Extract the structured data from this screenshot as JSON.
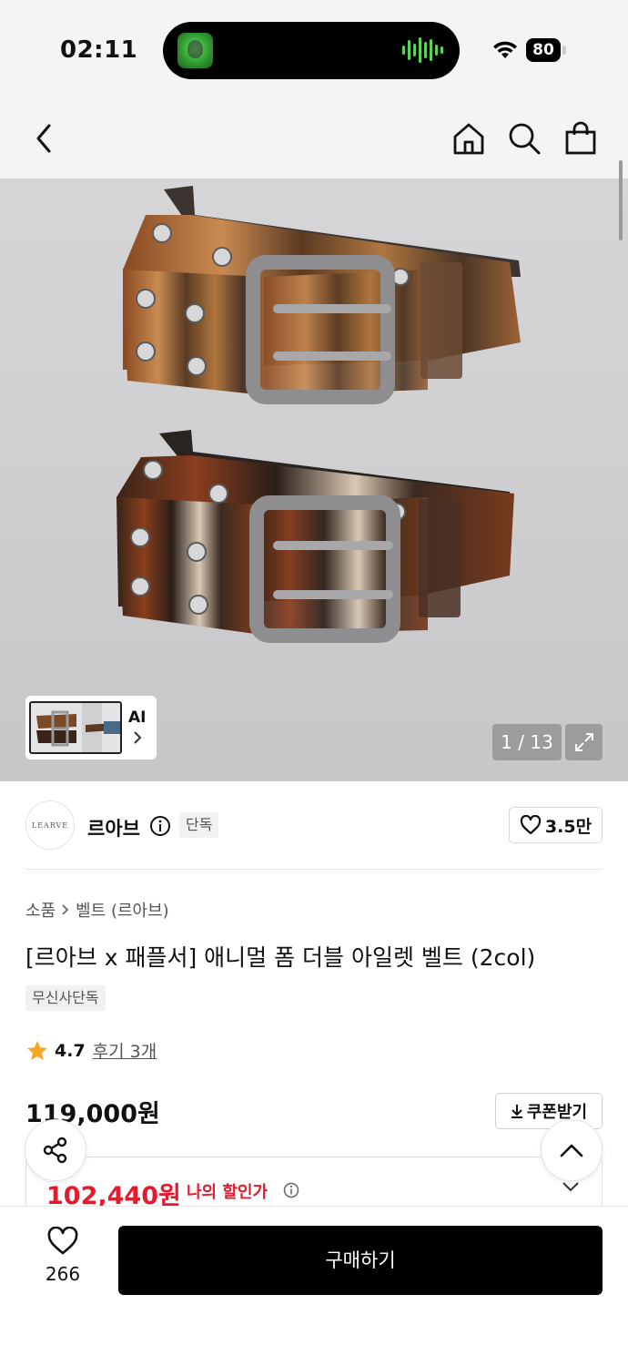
{
  "status_bar": {
    "time": "02:11",
    "battery": "80"
  },
  "top_nav": {
    "icons": [
      "back-icon",
      "home-icon",
      "search-icon",
      "bag-icon"
    ]
  },
  "gallery": {
    "thumbnail_label": "AI",
    "page_counter": "1 / 13",
    "current_index": 1,
    "total_images": 13
  },
  "brand": {
    "logo_text": "LEARVE",
    "name": "르아브",
    "exclusive_tag": "단독",
    "like_count": "3.5만"
  },
  "product": {
    "breadcrumb": [
      "소품",
      "벨트 (르아브)"
    ],
    "title": "[르아브 x 패플서] 애니멀 폼 더블 아일렛 벨트 (2col)",
    "store_tag": "무신사단독",
    "rating": "4.7",
    "review_link": "후기 3개",
    "original_price": "119,000원",
    "coupon_label": "쿠폰받기",
    "sale_price": "102,440원",
    "my_price_label": "나의 할인가"
  },
  "bottom_bar": {
    "wish_count": "266",
    "buy_label": "구매하기"
  },
  "colors": {
    "sale": "#e8192c",
    "buy_button": "#000000",
    "star": "#f5a623"
  }
}
